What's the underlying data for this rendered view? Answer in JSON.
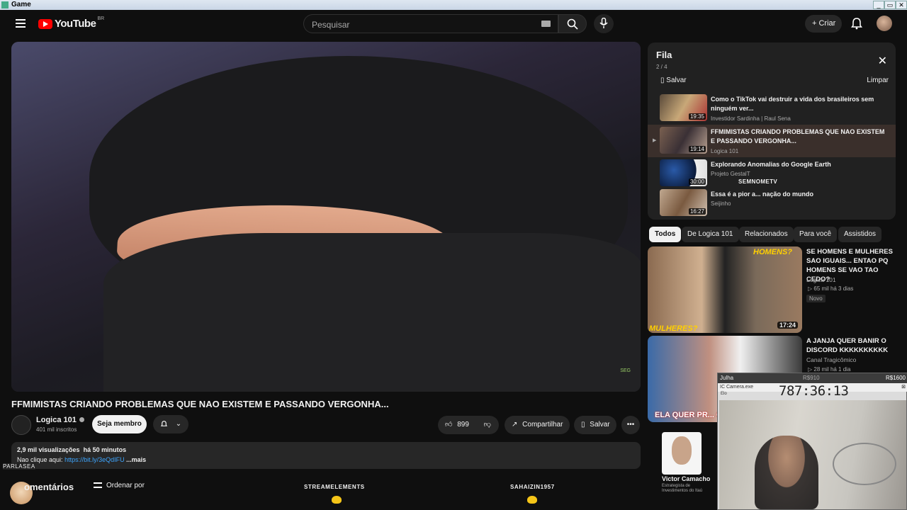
{
  "window": {
    "title": "Game",
    "buttons": [
      "_",
      "▭",
      "✕"
    ]
  },
  "header": {
    "logo_text": "YouTube",
    "region": "BR",
    "search_placeholder": "Pesquisar",
    "create_label": "Criar"
  },
  "video": {
    "title": "FFMIMISTAS CRIANDO PROBLEMAS QUE NAO EXISTEM E PASSANDO VERGONHA...",
    "watermark": "SEG",
    "channel_name": "Logica 101",
    "channel_subs": "401 mil inscritos",
    "join_label": "Seja membro",
    "likes": "899",
    "share_label": "Compartilhar",
    "save_label": "Salvar",
    "views": "2,9 mil visualizações",
    "posted": "há 50 minutos",
    "desc_prefix": "Nao clique aqui:",
    "desc_link": "https://bit.ly/3eQdIFU",
    "desc_more": "...mais",
    "comments_label": "Comentários",
    "comments_visible_suffix": "omentários",
    "order_by": "Ordenar por"
  },
  "overlays": {
    "parlasea": "PARLASEA",
    "stream_elements": "STREAMELEMENTS",
    "sahaizin": "SAHAIZIN1957",
    "semnome": "SEMNOMETV"
  },
  "queue": {
    "title": "Fila",
    "count": "2 / 4",
    "save": "Salvar",
    "clear": "Limpar",
    "items": [
      {
        "title": "Como o TikTok vai destruir a vida dos brasileiros sem ninguém ver...",
        "channel": "Investidor Sardinha | Raul Sena",
        "duration": "19:35"
      },
      {
        "title": "FFMIMISTAS CRIANDO PROBLEMAS QUE NAO EXISTEM E PASSANDO VERGONHA...",
        "channel": "Logica 101",
        "duration": "19:14"
      },
      {
        "title": "Explorando Anomalias do Google Earth",
        "channel": "Projeto GestalT",
        "duration": "30:00"
      },
      {
        "title": "Essa é a pior a... nação do mundo",
        "channel": "Seijinho",
        "duration": "16:27"
      }
    ]
  },
  "chips": [
    "Todos",
    "De Logica 101",
    "Relacionados",
    "Para você",
    "Assistidos"
  ],
  "recommendations": [
    {
      "title": "SE HOMENS E MULHERES SAO IGUAIS... ENTAO PQ HOMENS SE VAO TAO CEDO?",
      "channel": "Logica 101",
      "meta": "▷ 65 mil   há 3 dias",
      "badge": "Novo",
      "duration": "17:24",
      "thumb_top": "HOMENS?",
      "thumb_bottom": "MULHERES?"
    },
    {
      "title": "A JANJA QUER BANIR O DISCORD KKKKKKKKKK",
      "channel": "Canal Tragicômico",
      "meta": "▷ 28 mil   há 1 dia",
      "thumb_bottom": "ELA QUER PR... O DISCORD K..."
    }
  ],
  "side_third": {
    "name": "Victor Camacho",
    "sub": "Estrategista de Investimentos do Itaú"
  },
  "webcam": {
    "name": "Julha",
    "amount_a": "R$910",
    "amount_b": "R$1600",
    "window_label": "IC Camera.exe",
    "timer": "787:36:13",
    "sub_label": "Elo"
  }
}
